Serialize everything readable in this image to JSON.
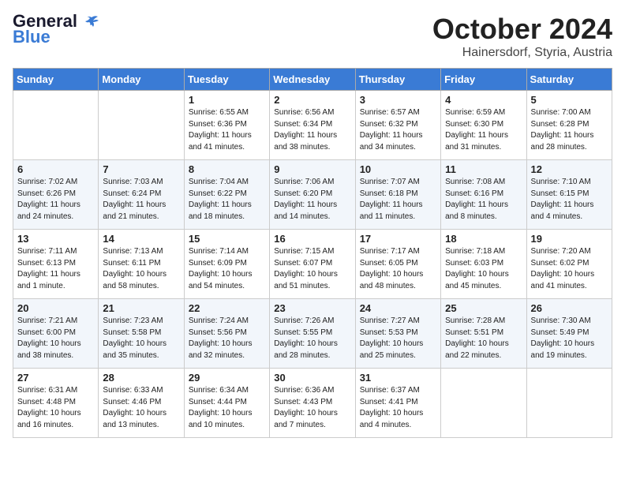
{
  "header": {
    "logo_line1": "General",
    "logo_line2": "Blue",
    "month": "October 2024",
    "location": "Hainersdorf, Styria, Austria"
  },
  "weekdays": [
    "Sunday",
    "Monday",
    "Tuesday",
    "Wednesday",
    "Thursday",
    "Friday",
    "Saturday"
  ],
  "weeks": [
    [
      {
        "day": "",
        "sunrise": "",
        "sunset": "",
        "daylight": ""
      },
      {
        "day": "",
        "sunrise": "",
        "sunset": "",
        "daylight": ""
      },
      {
        "day": "1",
        "sunrise": "Sunrise: 6:55 AM",
        "sunset": "Sunset: 6:36 PM",
        "daylight": "Daylight: 11 hours and 41 minutes."
      },
      {
        "day": "2",
        "sunrise": "Sunrise: 6:56 AM",
        "sunset": "Sunset: 6:34 PM",
        "daylight": "Daylight: 11 hours and 38 minutes."
      },
      {
        "day": "3",
        "sunrise": "Sunrise: 6:57 AM",
        "sunset": "Sunset: 6:32 PM",
        "daylight": "Daylight: 11 hours and 34 minutes."
      },
      {
        "day": "4",
        "sunrise": "Sunrise: 6:59 AM",
        "sunset": "Sunset: 6:30 PM",
        "daylight": "Daylight: 11 hours and 31 minutes."
      },
      {
        "day": "5",
        "sunrise": "Sunrise: 7:00 AM",
        "sunset": "Sunset: 6:28 PM",
        "daylight": "Daylight: 11 hours and 28 minutes."
      }
    ],
    [
      {
        "day": "6",
        "sunrise": "Sunrise: 7:02 AM",
        "sunset": "Sunset: 6:26 PM",
        "daylight": "Daylight: 11 hours and 24 minutes."
      },
      {
        "day": "7",
        "sunrise": "Sunrise: 7:03 AM",
        "sunset": "Sunset: 6:24 PM",
        "daylight": "Daylight: 11 hours and 21 minutes."
      },
      {
        "day": "8",
        "sunrise": "Sunrise: 7:04 AM",
        "sunset": "Sunset: 6:22 PM",
        "daylight": "Daylight: 11 hours and 18 minutes."
      },
      {
        "day": "9",
        "sunrise": "Sunrise: 7:06 AM",
        "sunset": "Sunset: 6:20 PM",
        "daylight": "Daylight: 11 hours and 14 minutes."
      },
      {
        "day": "10",
        "sunrise": "Sunrise: 7:07 AM",
        "sunset": "Sunset: 6:18 PM",
        "daylight": "Daylight: 11 hours and 11 minutes."
      },
      {
        "day": "11",
        "sunrise": "Sunrise: 7:08 AM",
        "sunset": "Sunset: 6:16 PM",
        "daylight": "Daylight: 11 hours and 8 minutes."
      },
      {
        "day": "12",
        "sunrise": "Sunrise: 7:10 AM",
        "sunset": "Sunset: 6:15 PM",
        "daylight": "Daylight: 11 hours and 4 minutes."
      }
    ],
    [
      {
        "day": "13",
        "sunrise": "Sunrise: 7:11 AM",
        "sunset": "Sunset: 6:13 PM",
        "daylight": "Daylight: 11 hours and 1 minute."
      },
      {
        "day": "14",
        "sunrise": "Sunrise: 7:13 AM",
        "sunset": "Sunset: 6:11 PM",
        "daylight": "Daylight: 10 hours and 58 minutes."
      },
      {
        "day": "15",
        "sunrise": "Sunrise: 7:14 AM",
        "sunset": "Sunset: 6:09 PM",
        "daylight": "Daylight: 10 hours and 54 minutes."
      },
      {
        "day": "16",
        "sunrise": "Sunrise: 7:15 AM",
        "sunset": "Sunset: 6:07 PM",
        "daylight": "Daylight: 10 hours and 51 minutes."
      },
      {
        "day": "17",
        "sunrise": "Sunrise: 7:17 AM",
        "sunset": "Sunset: 6:05 PM",
        "daylight": "Daylight: 10 hours and 48 minutes."
      },
      {
        "day": "18",
        "sunrise": "Sunrise: 7:18 AM",
        "sunset": "Sunset: 6:03 PM",
        "daylight": "Daylight: 10 hours and 45 minutes."
      },
      {
        "day": "19",
        "sunrise": "Sunrise: 7:20 AM",
        "sunset": "Sunset: 6:02 PM",
        "daylight": "Daylight: 10 hours and 41 minutes."
      }
    ],
    [
      {
        "day": "20",
        "sunrise": "Sunrise: 7:21 AM",
        "sunset": "Sunset: 6:00 PM",
        "daylight": "Daylight: 10 hours and 38 minutes."
      },
      {
        "day": "21",
        "sunrise": "Sunrise: 7:23 AM",
        "sunset": "Sunset: 5:58 PM",
        "daylight": "Daylight: 10 hours and 35 minutes."
      },
      {
        "day": "22",
        "sunrise": "Sunrise: 7:24 AM",
        "sunset": "Sunset: 5:56 PM",
        "daylight": "Daylight: 10 hours and 32 minutes."
      },
      {
        "day": "23",
        "sunrise": "Sunrise: 7:26 AM",
        "sunset": "Sunset: 5:55 PM",
        "daylight": "Daylight: 10 hours and 28 minutes."
      },
      {
        "day": "24",
        "sunrise": "Sunrise: 7:27 AM",
        "sunset": "Sunset: 5:53 PM",
        "daylight": "Daylight: 10 hours and 25 minutes."
      },
      {
        "day": "25",
        "sunrise": "Sunrise: 7:28 AM",
        "sunset": "Sunset: 5:51 PM",
        "daylight": "Daylight: 10 hours and 22 minutes."
      },
      {
        "day": "26",
        "sunrise": "Sunrise: 7:30 AM",
        "sunset": "Sunset: 5:49 PM",
        "daylight": "Daylight: 10 hours and 19 minutes."
      }
    ],
    [
      {
        "day": "27",
        "sunrise": "Sunrise: 6:31 AM",
        "sunset": "Sunset: 4:48 PM",
        "daylight": "Daylight: 10 hours and 16 minutes."
      },
      {
        "day": "28",
        "sunrise": "Sunrise: 6:33 AM",
        "sunset": "Sunset: 4:46 PM",
        "daylight": "Daylight: 10 hours and 13 minutes."
      },
      {
        "day": "29",
        "sunrise": "Sunrise: 6:34 AM",
        "sunset": "Sunset: 4:44 PM",
        "daylight": "Daylight: 10 hours and 10 minutes."
      },
      {
        "day": "30",
        "sunrise": "Sunrise: 6:36 AM",
        "sunset": "Sunset: 4:43 PM",
        "daylight": "Daylight: 10 hours and 7 minutes."
      },
      {
        "day": "31",
        "sunrise": "Sunrise: 6:37 AM",
        "sunset": "Sunset: 4:41 PM",
        "daylight": "Daylight: 10 hours and 4 minutes."
      },
      {
        "day": "",
        "sunrise": "",
        "sunset": "",
        "daylight": ""
      },
      {
        "day": "",
        "sunrise": "",
        "sunset": "",
        "daylight": ""
      }
    ]
  ]
}
